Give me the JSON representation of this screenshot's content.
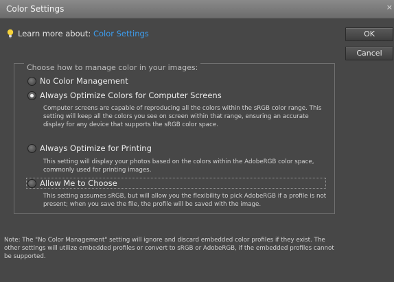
{
  "window": {
    "title": "Color Settings",
    "close_glyph": "×"
  },
  "learn": {
    "prefix": "Learn more about:",
    "link": "Color Settings"
  },
  "buttons": {
    "ok": "OK",
    "cancel": "Cancel"
  },
  "group": {
    "legend": "Choose how to manage color in your images:",
    "options": [
      {
        "label": "No Color Management",
        "checked": false,
        "description": ""
      },
      {
        "label": "Always Optimize Colors for Computer Screens",
        "checked": true,
        "description": "Computer screens are capable of reproducing all the colors within the sRGB color range. This setting will keep all the colors you see on screen within that range, ensuring an accurate display for any device that supports the sRGB color space."
      },
      {
        "label": "Always Optimize for Printing",
        "checked": false,
        "description": "This setting will display your photos based on the colors within the AdobeRGB color space, commonly used for printing images."
      },
      {
        "label": "Allow Me to Choose",
        "checked": false,
        "description": "This setting assumes sRGB, but will allow you the flexibility to pick AdobeRGB if a profile is not present; when you save the file, the profile will be saved with the image."
      }
    ]
  },
  "note": "Note: The \"No Color Management\" setting will ignore and discard embedded color profiles if they exist. The other settings will utilize embedded profiles or convert to sRGB or AdobeRGB, if the embedded profiles cannot be supported.",
  "icons": {
    "bulb": "lightbulb-icon",
    "bulb_color": "#f5d23a",
    "link_color": "#3d9ef0"
  }
}
